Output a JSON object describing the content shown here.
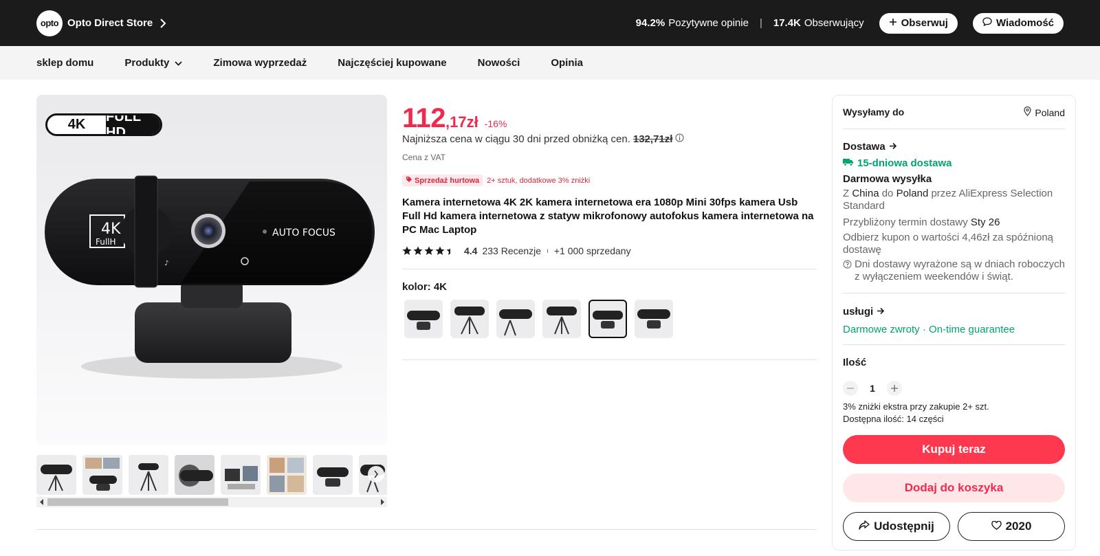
{
  "store": {
    "logo_text": "opto",
    "name": "Opto Direct Store",
    "positive_value": "94.2%",
    "positive_label": "Pozytywne opinie",
    "separator": "|",
    "followers_value": "17.4K",
    "followers_label": "Obserwujący",
    "follow_label": "Obserwuj",
    "message_label": "Wiadomość"
  },
  "nav": {
    "home": "sklep domu",
    "products": "Produkty",
    "winter_sale": "Zimowa wyprzedaż",
    "best_sellers": "Najczęściej kupowane",
    "new": "Nowości",
    "reviews": "Opinia"
  },
  "gallery": {
    "badge_left": "4K",
    "badge_right": "FULL HD",
    "camera_text": "AUTO FOCUS",
    "thumbnail_count": 8,
    "scroll_fraction": 0.55
  },
  "product": {
    "price_int": "112",
    "price_dec": ",17zł",
    "discount": "-16%",
    "lowest_text": "Najniższa cena w ciągu 30 dni przed obniżką cen.",
    "lowest_old": "132,71zł",
    "vat": "Cena z VAT",
    "wholesale_badge": "Sprzedaż hurtowa",
    "wholesale_text": "2+ sztuk, dodatkowe 3% zniżki",
    "title": "Kamera internetowa 4K 2K kamera internetowa era 1080p Mini 30fps kamera Usb Full Hd kamera internetowa z statyw mikrofonowy autofokus kamera internetowa na PC Mac Laptop",
    "rating": "4.4",
    "rating_num": 4.4,
    "reviews": "233 Recenzje",
    "sep": "ı",
    "sold": "+1 000 sprzedany",
    "color_label": "kolor: 4K",
    "swatch_count": 6,
    "selected_swatch": 5
  },
  "panel": {
    "ship_to_label": "Wysyłamy do",
    "ship_to_country": "Poland",
    "delivery_title": "Dostawa",
    "delivery_days": "15-dniowa dostawa",
    "free_shipping": "Darmowa wysyłka",
    "route_z": "Z",
    "route_from": "China",
    "route_do": "do",
    "route_to": "Poland",
    "route_via": "przez AliExpress Selection Standard",
    "eta_label": "Przybliżony termin dostawy",
    "eta_value": "Sty 26",
    "coupon_text": "Odbierz kupon o wartości 4,46zł za spóźnioną dostawę",
    "days_note": "Dni dostawy wyrażone są w dniach roboczych z wyłączeniem weekendów i świąt.",
    "services_title": "usługi",
    "free_returns": "Darmowe zwroty",
    "dot": "·",
    "on_time": "On-time guarantee",
    "qty_title": "Ilość",
    "qty_value": "1",
    "extra_discount": "3% zniżki ekstra przy zakupie 2+ szt.",
    "available": "Dostępna ilość: 14 części",
    "buy_label": "Kupuj teraz",
    "cart_label": "Dodaj do koszyka",
    "share_label": "Udostępnij",
    "wishlist_count": "2020"
  },
  "colors": {
    "accent": "#fd384f",
    "price": "#f1294d",
    "green": "#00a56a",
    "dark": "#1b1b1b"
  }
}
